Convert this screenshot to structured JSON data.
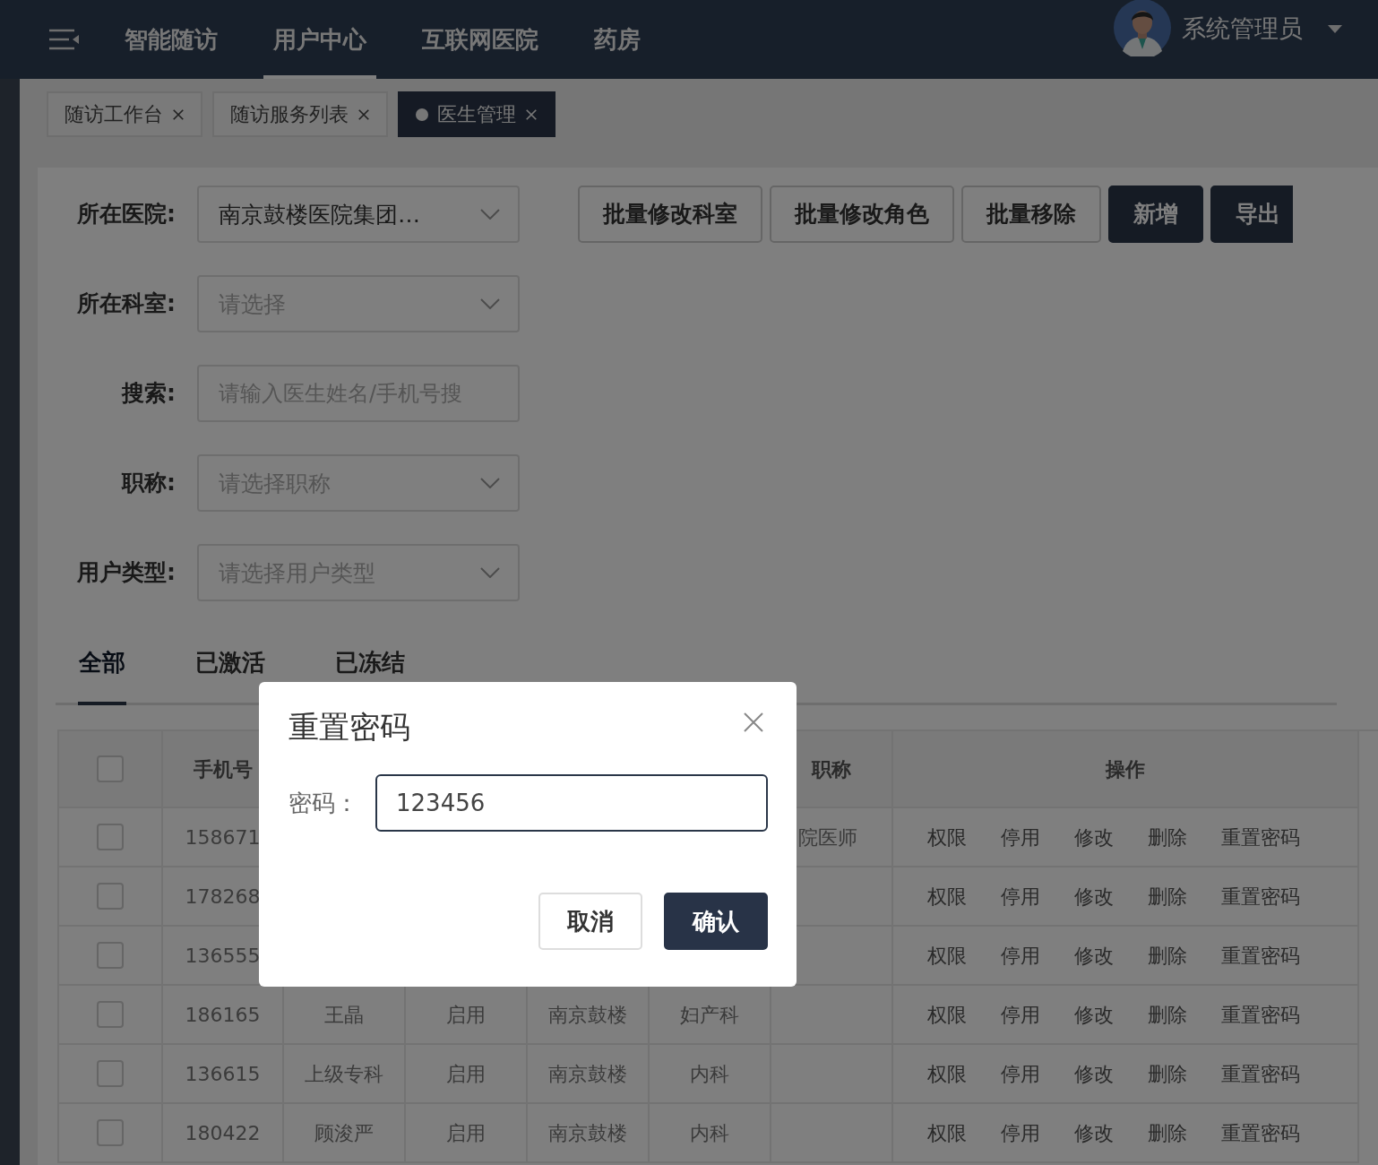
{
  "navbar": {
    "menu": [
      {
        "label": "智能随访",
        "selected": false
      },
      {
        "label": "用户中心",
        "selected": true
      },
      {
        "label": "互联网医院",
        "selected": false
      },
      {
        "label": "药房",
        "selected": false
      }
    ],
    "user": "系统管理员"
  },
  "tabs": [
    {
      "label": "随访工作台",
      "selected": false
    },
    {
      "label": "随访服务列表",
      "selected": false
    },
    {
      "label": "医生管理",
      "selected": true
    }
  ],
  "filters": [
    {
      "label": "所在医院:",
      "kind": "select",
      "value": "南京鼓楼医院集团…"
    },
    {
      "label": "所在科室:",
      "kind": "select",
      "placeholder": "请选择"
    },
    {
      "label": "搜索:",
      "kind": "input",
      "placeholder": "请输入医生姓名/手机号搜"
    },
    {
      "label": "职称:",
      "kind": "select",
      "placeholder": "请选择职称"
    },
    {
      "label": "用户类型:",
      "kind": "select",
      "placeholder": "请选择用户类型"
    }
  ],
  "toolbar": [
    {
      "label": "批量修改科室",
      "kind": "outline"
    },
    {
      "label": "批量修改角色",
      "kind": "outline"
    },
    {
      "label": "批量移除",
      "kind": "outline"
    },
    {
      "label": "新增",
      "kind": "solid"
    },
    {
      "label": "导出",
      "kind": "solid"
    }
  ],
  "status_tabs": [
    {
      "label": "全部",
      "selected": true
    },
    {
      "label": "已激活",
      "selected": false
    },
    {
      "label": "已冻结",
      "selected": false
    }
  ],
  "table": {
    "header": {
      "checked": false,
      "phone": "手机号",
      "title": "职称",
      "actions": "操作"
    },
    "rows": [
      {
        "checked": false,
        "phone": "158671",
        "title": "院医师",
        "actions": [
          "权限",
          "停用",
          "修改",
          "删除",
          "重置密码"
        ]
      },
      {
        "checked": false,
        "phone": "178268",
        "actions": [
          "权限",
          "停用",
          "修改",
          "删除",
          "重置密码"
        ]
      },
      {
        "checked": false,
        "phone": "136555",
        "actions": [
          "权限",
          "停用",
          "修改",
          "删除",
          "重置密码"
        ]
      },
      {
        "checked": false,
        "phone": "186165",
        "column_3": "王晶",
        "column_4": "启用",
        "column_5": "南京鼓楼",
        "column_6": "妇产科",
        "actions": [
          "权限",
          "停用",
          "修改",
          "删除",
          "重置密码"
        ]
      },
      {
        "checked": false,
        "phone": "136615",
        "column_3": "上级专科",
        "column_4": "启用",
        "column_5": "南京鼓楼",
        "column_6": "内科",
        "actions": [
          "权限",
          "停用",
          "修改",
          "删除",
          "重置密码"
        ]
      },
      {
        "checked": false,
        "phone": "180422",
        "column_3": "顾浚严",
        "column_4": "启用",
        "column_5": "南京鼓楼",
        "column_6": "内科",
        "actions": [
          "权限",
          "停用",
          "修改",
          "删除",
          "重置密码"
        ]
      }
    ]
  },
  "dialog": {
    "title": "重置密码",
    "field": {
      "label": "密码：",
      "value": "123456"
    },
    "buttons": [
      {
        "label": "取消",
        "kind": "default"
      },
      {
        "label": "确认",
        "kind": "primary"
      }
    ]
  }
}
